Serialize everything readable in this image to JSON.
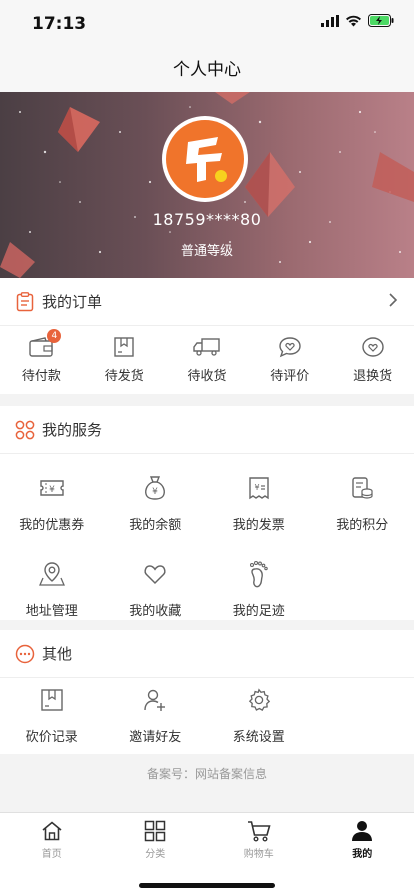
{
  "status": {
    "time": "17:13"
  },
  "header": {
    "title": "个人中心"
  },
  "profile": {
    "logo_char": "乐",
    "phone": "18759****80",
    "level": "普通等级"
  },
  "orders": {
    "title": "我的订单",
    "items": [
      {
        "label": "待付款",
        "icon": "wallet-icon",
        "badge": "4"
      },
      {
        "label": "待发货",
        "icon": "box-icon"
      },
      {
        "label": "待收货",
        "icon": "truck-icon"
      },
      {
        "label": "待评价",
        "icon": "comment-heart-icon"
      },
      {
        "label": "退换货",
        "icon": "return-heart-icon"
      }
    ]
  },
  "services": {
    "title": "我的服务",
    "items": [
      {
        "label": "我的优惠券",
        "icon": "coupon-icon"
      },
      {
        "label": "我的余额",
        "icon": "money-bag-icon"
      },
      {
        "label": "我的发票",
        "icon": "invoice-icon"
      },
      {
        "label": "我的积分",
        "icon": "points-icon"
      },
      {
        "label": "地址管理",
        "icon": "location-icon"
      },
      {
        "label": "我的收藏",
        "icon": "heart-icon"
      },
      {
        "label": "我的足迹",
        "icon": "footprint-icon"
      }
    ]
  },
  "others": {
    "title": "其他",
    "items": [
      {
        "label": "砍价记录",
        "icon": "bargain-icon"
      },
      {
        "label": "邀请好友",
        "icon": "invite-user-icon"
      },
      {
        "label": "系统设置",
        "icon": "settings-gear-icon"
      }
    ]
  },
  "footer": {
    "record": "备案号：网站备案信息"
  },
  "tabs": [
    {
      "label": "首页",
      "icon": "home-icon"
    },
    {
      "label": "分类",
      "icon": "category-grid-icon"
    },
    {
      "label": "购物车",
      "icon": "cart-icon"
    },
    {
      "label": "我的",
      "icon": "user-icon",
      "active": true
    }
  ],
  "colors": {
    "accent": "#f0742b",
    "badge": "#e8633c",
    "section_icon": "#e8633c"
  }
}
